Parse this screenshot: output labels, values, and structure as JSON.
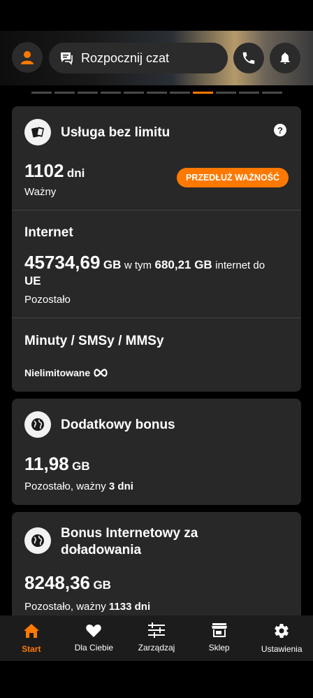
{
  "header": {
    "chat_label": "Rozpocznij czat"
  },
  "pager": {
    "count": 11,
    "active_index": 7
  },
  "unlimited_card": {
    "title": "Usługa bez limitu",
    "help_glyph": "?",
    "days_value": "1102",
    "days_unit": "dni",
    "status": "Ważny",
    "extend_button": "PRZEDŁUŻ WAŻNOŚĆ",
    "internet_title": "Internet",
    "internet_value": "45734,69",
    "internet_unit": "GB",
    "internet_mid": "w tym",
    "internet_eu_value": "680,21 GB",
    "internet_eu_text": "internet do",
    "internet_eu_label": "UE",
    "internet_remaining": "Pozostało",
    "minutes_title": "Minuty / SMSy / MMSy",
    "minutes_value": "Nielimitowane"
  },
  "bonus_card": {
    "title": "Dodatkowy bonus",
    "value": "11,98",
    "unit": "GB",
    "remaining": "Pozostało, ważny",
    "days": "3 dni"
  },
  "topup_card": {
    "title_line1": "Bonus Internetowy za",
    "title_line2": "doładowania",
    "value": "8248,36",
    "unit": "GB",
    "remaining": "Pozostało, ważny",
    "days": "1133 dni"
  },
  "nav": {
    "items": [
      {
        "label": "Start",
        "icon": "home-icon"
      },
      {
        "label": "Dla Ciebie",
        "icon": "heart-icon"
      },
      {
        "label": "Zarządzaj",
        "icon": "sliders-icon"
      },
      {
        "label": "Sklep",
        "icon": "shop-icon"
      },
      {
        "label": "Ustawienia",
        "icon": "gear-icon"
      }
    ],
    "active_color": "#ff7900"
  }
}
